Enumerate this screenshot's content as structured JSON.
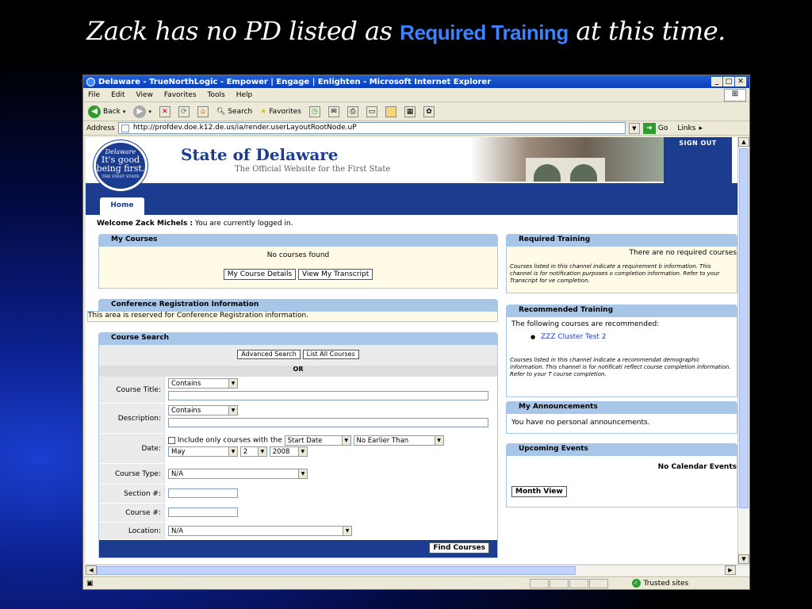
{
  "slide": {
    "title_prefix": "Zack has no PD listed as ",
    "title_highlight": "Required Training",
    "title_suffix": " at this time."
  },
  "window": {
    "title": "Delaware - TrueNorthLogic - Empower | Engage | Enlighten - Microsoft Internet Explorer",
    "menu": [
      "File",
      "Edit",
      "View",
      "Favorites",
      "Tools",
      "Help"
    ],
    "toolbar": {
      "back": "Back",
      "search": "Search",
      "favorites": "Favorites"
    },
    "address_label": "Address",
    "url": "http://profdev.doe.k12.de.us/ia/render.userLayoutRootNode.uP",
    "go": "Go",
    "links": "Links",
    "status_zone": "Trusted sites"
  },
  "site": {
    "seal_line1": "Delaware",
    "seal_line2": "It's good being first.",
    "seal_line3": "THE FIRST STATE",
    "title": "State of Delaware",
    "subtitle": "The Official Website for the First State",
    "sign_out": "SIGN OUT",
    "tab_home": "Home",
    "welcome_name": "Welcome Zack Michels :",
    "welcome_msg": " You are currently logged in."
  },
  "my_courses": {
    "header": "My Courses",
    "empty": "No courses found",
    "btn_details": "My Course Details",
    "btn_transcript": "View My Transcript"
  },
  "conference": {
    "header": "Conference Registration Information",
    "body": "This area is reserved for Conference Registration information."
  },
  "course_search": {
    "header": "Course Search",
    "btn_advanced": "Advanced Search",
    "btn_list_all": "List All Courses",
    "or": "OR",
    "labels": {
      "title": "Course Title:",
      "description": "Description:",
      "date": "Date:",
      "type": "Course Type:",
      "section": "Section #:",
      "course_no": "Course #:",
      "location": "Location:"
    },
    "title_op": "Contains",
    "description_op": "Contains",
    "date_include": "Include only courses with the",
    "date_field": "Start Date",
    "date_cmp": "No Earlier Than",
    "date_month": "May",
    "date_day": "2",
    "date_year": "2008",
    "type_value": "N/A",
    "location_value": "N/A",
    "btn_find": "Find Courses"
  },
  "required_training": {
    "header": "Required Training",
    "empty": "There are no required courses",
    "note": "Courses listed in this channel indicate a requirement b information. This channel is for notification purposes o completion information. Refer to your Transcript for ve completion."
  },
  "recommended_training": {
    "header": "Recommended Training",
    "intro": "The following courses are recommended:",
    "items": [
      "ZZZ Cluster Test 2"
    ],
    "note": "Courses listed in this channel indicate a recommendat demographic information. This channel is for notificati reflect course completion information. Refer to your T course completion."
  },
  "announcements": {
    "header": "My Announcements",
    "body": "You have no personal announcements."
  },
  "events": {
    "header": "Upcoming Events",
    "empty": "No Calendar Events",
    "btn_month": "Month View"
  }
}
